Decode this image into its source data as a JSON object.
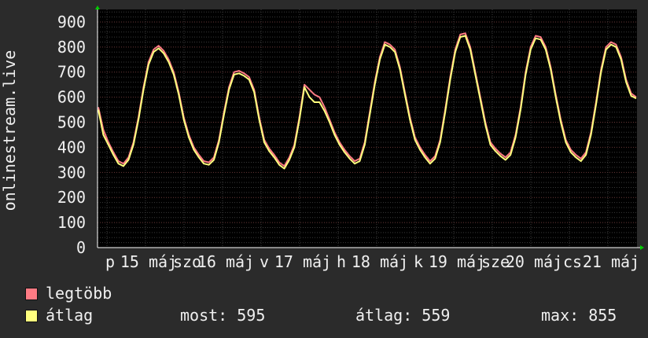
{
  "chart_data": {
    "type": "line",
    "ylabel": "onlinestream.live",
    "ylim": [
      0,
      950
    ],
    "yticks": [
      0,
      100,
      200,
      300,
      400,
      500,
      600,
      700,
      800,
      900
    ],
    "xtick_labels": [
      "p",
      "15 máj",
      "szo",
      "16 máj",
      "v",
      "17 máj",
      "h",
      "18 máj",
      "k",
      "19 máj",
      "sze",
      "20 máj",
      "cs",
      "21 máj"
    ],
    "grid": true,
    "series": [
      {
        "name": "legtöbb",
        "color": "#ff7b84",
        "values": [
          560,
          470,
          420,
          380,
          345,
          335,
          360,
          420,
          520,
          640,
          740,
          790,
          805,
          785,
          750,
          700,
          620,
          520,
          450,
          400,
          370,
          345,
          340,
          360,
          430,
          540,
          640,
          700,
          705,
          695,
          680,
          630,
          520,
          430,
          395,
          370,
          340,
          325,
          360,
          410,
          520,
          650,
          630,
          610,
          600,
          560,
          510,
          460,
          420,
          390,
          365,
          345,
          355,
          420,
          540,
          660,
          760,
          820,
          810,
          790,
          720,
          620,
          520,
          440,
          400,
          370,
          345,
          365,
          430,
          550,
          680,
          790,
          850,
          855,
          800,
          700,
          600,
          500,
          420,
          395,
          375,
          360,
          380,
          450,
          560,
          700,
          800,
          845,
          840,
          800,
          720,
          610,
          510,
          430,
          390,
          370,
          355,
          380,
          460,
          580,
          710,
          800,
          820,
          810,
          760,
          670,
          615,
          600
        ]
      },
      {
        "name": "átlag",
        "color": "#ffff7e",
        "values": [
          550,
          450,
          410,
          370,
          335,
          325,
          350,
          410,
          510,
          630,
          730,
          780,
          795,
          775,
          740,
          690,
          610,
          510,
          440,
          390,
          360,
          335,
          330,
          350,
          420,
          530,
          630,
          690,
          695,
          685,
          670,
          620,
          510,
          420,
          385,
          360,
          330,
          315,
          350,
          400,
          510,
          640,
          600,
          580,
          580,
          545,
          500,
          450,
          410,
          380,
          355,
          335,
          345,
          410,
          530,
          650,
          750,
          810,
          800,
          780,
          710,
          610,
          510,
          430,
          390,
          360,
          335,
          355,
          420,
          540,
          670,
          780,
          840,
          845,
          790,
          690,
          590,
          490,
          410,
          385,
          365,
          350,
          370,
          440,
          550,
          690,
          790,
          835,
          830,
          790,
          710,
          600,
          500,
          420,
          380,
          360,
          345,
          370,
          450,
          570,
          700,
          790,
          810,
          800,
          750,
          660,
          605,
          595
        ]
      }
    ]
  },
  "legend": {
    "max_label": "legtöbb",
    "avg_label": "átlag",
    "max_color": "#ff7b84",
    "avg_color": "#ffff7e"
  },
  "stats": {
    "now": "most: 595",
    "avg": "átlag: 559",
    "max": "max: 855"
  }
}
